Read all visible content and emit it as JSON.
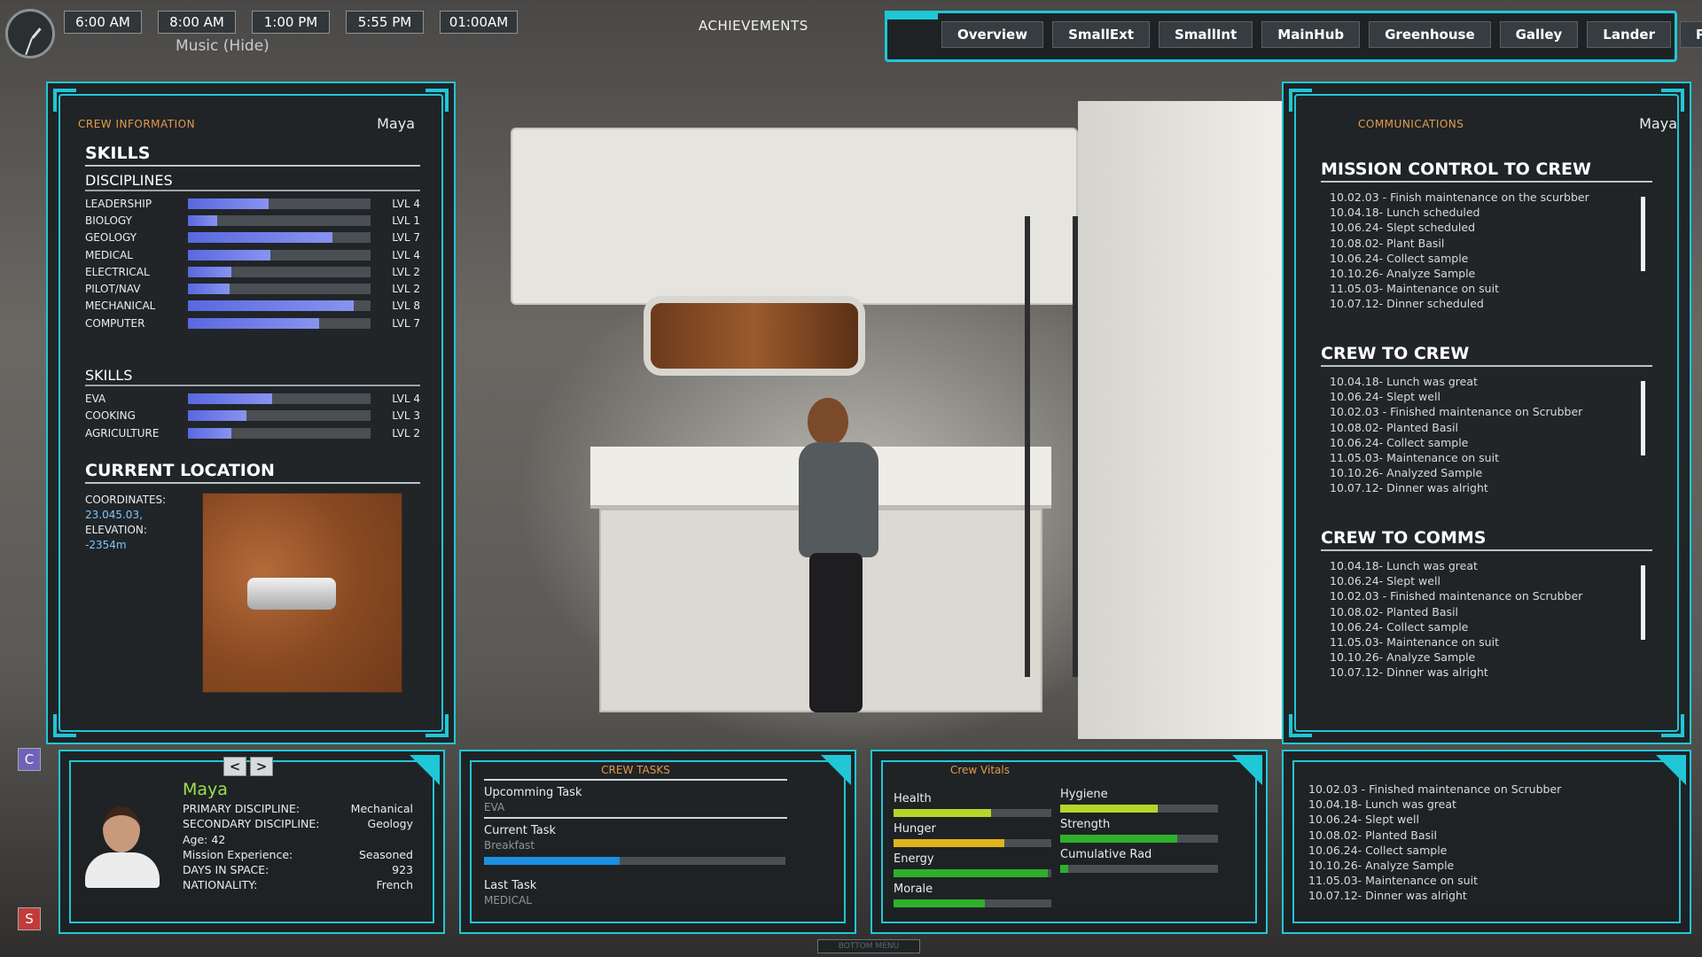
{
  "top": {
    "times": [
      "6:00 AM",
      "8:00 AM",
      "1:00 PM",
      "5:55 PM",
      "01:00AM"
    ],
    "music_label": "Music (Hide)",
    "achievements_label": "ACHIEVEMENTS"
  },
  "nav": {
    "tabs": [
      "Overview",
      "SmallExt",
      "SmallInt",
      "MainHub",
      "Greenhouse",
      "Galley",
      "Lander",
      "PEV"
    ]
  },
  "crew_info": {
    "header": "CREW INFORMATION",
    "crew_name": "Maya",
    "skills_title": "SKILLS",
    "disciplines_title": "DISCIPLINES",
    "disciplines": [
      {
        "name": "LEADERSHIP",
        "level": "LVL 4",
        "fill": 0.44
      },
      {
        "name": "BIOLOGY",
        "level": "LVL 1",
        "fill": 0.16
      },
      {
        "name": "GEOLOGY",
        "level": "LVL 7",
        "fill": 0.79
      },
      {
        "name": "MEDICAL",
        "level": "LVL 4",
        "fill": 0.45
      },
      {
        "name": "ELECTRICAL",
        "level": "LVL 2",
        "fill": 0.24
      },
      {
        "name": "PILOT/NAV",
        "level": "LVL 2",
        "fill": 0.23
      },
      {
        "name": "MECHANICAL",
        "level": "LVL 8",
        "fill": 0.91
      },
      {
        "name": "COMPUTER",
        "level": "LVL 7",
        "fill": 0.72
      }
    ],
    "skills_sub_title": "SKILLS",
    "skills": [
      {
        "name": "EVA",
        "level": "LVL 4",
        "fill": 0.46
      },
      {
        "name": "COOKING",
        "level": "LVL 3",
        "fill": 0.32
      },
      {
        "name": "AGRICULTURE",
        "level": "LVL 2",
        "fill": 0.24
      }
    ],
    "location_title": "CURRENT LOCATION",
    "coordinates_label": "COORDINATES:",
    "coordinates_value": "23.045.03,",
    "elevation_label": "ELEVATION:",
    "elevation_value": "-2354m"
  },
  "comms": {
    "header": "COMMUNICATIONS",
    "crew_name": "Maya",
    "mission_title": "MISSION CONTROL TO CREW",
    "mission": [
      "10.02.03 - Finish maintenance on the scurbber",
      "10.04.18- Lunch scheduled",
      "10.06.24- Slept scheduled",
      "10.08.02- Plant Basil",
      "10.06.24- Collect sample",
      "10.10.26- Analyze Sample",
      "11.05.03- Maintenance on suit",
      "10.07.12- Dinner scheduled"
    ],
    "crew_title": "CREW TO CREW",
    "crew": [
      "10.04.18- Lunch was great",
      "10.06.24- Slept well",
      "10.02.03 - Finished maintenance on Scrubber",
      "10.08.02- Planted Basil",
      "10.06.24- Collect sample",
      "11.05.03- Maintenance on suit",
      "10.10.26- Analyzed Sample",
      "10.07.12- Dinner was alright"
    ],
    "comms_title": "CREW TO COMMS",
    "to_comms": [
      "10.04.18- Lunch was great",
      "10.06.24- Slept well",
      "10.02.03 - Finished maintenance on Scrubber",
      "10.08.02- Planted Basil",
      "10.06.24- Collect sample",
      "11.05.03- Maintenance on suit",
      "10.10.26- Analyze Sample",
      "10.07.12- Dinner was alright"
    ]
  },
  "profile": {
    "prev": "<",
    "next": ">",
    "name": "Maya",
    "fields": [
      {
        "label": "PRIMARY DISCIPLINE:",
        "value": "Mechanical"
      },
      {
        "label": "SECONDARY DISCIPLINE:",
        "value": "Geology"
      },
      {
        "label": "Age: 42",
        "value": ""
      },
      {
        "label": "Mission Experience:",
        "value": "Seasoned"
      },
      {
        "label": "DAYS IN SPACE:",
        "value": "923"
      },
      {
        "label": "NATIONALITY:",
        "value": "French"
      }
    ]
  },
  "tasks": {
    "title": "CREW TASKS",
    "upcoming_label": "Upcomming Task",
    "upcoming_value": "EVA",
    "current_label": "Current Task",
    "current_value": "Breakfast",
    "current_progress": 0.45,
    "last_label": "Last Task",
    "last_value": "MEDICAL"
  },
  "vitals": {
    "title": "Crew Vitals",
    "items": [
      {
        "name": "Health",
        "value": 0.62,
        "color": "#b8d62a"
      },
      {
        "name": "Hunger",
        "value": 0.7,
        "color": "#e0b41c"
      },
      {
        "name": "Energy",
        "value": 0.98,
        "color": "#2fb02a"
      },
      {
        "name": "Morale",
        "value": 0.58,
        "color": "#2fb02a"
      },
      {
        "name": "Hygiene",
        "value": 0.62,
        "color": "#b8d62a"
      },
      {
        "name": "Strength",
        "value": 0.74,
        "color": "#2fb02a"
      },
      {
        "name": "Cumulative Rad",
        "value": 0.05,
        "color": "#2fb02a"
      }
    ]
  },
  "log": [
    "10.02.03 - Finished maintenance on Scrubber",
    "10.04.18- Lunch was great",
    "10.06.24- Slept well",
    "10.08.02- Planted Basil",
    "10.06.24- Collect sample",
    "10.10.26- Analyze Sample",
    "11.05.03- Maintenance on suit",
    "10.07.12- Dinner was alright"
  ],
  "side": {
    "c_label": "C",
    "s_label": "S"
  },
  "bottom_menu": "BOTTOM MENU",
  "colors": {
    "accent": "#1fc7d7",
    "header_orange": "#e39a4c",
    "name_green": "#9be04a",
    "skill_bar": "#6a76e6"
  }
}
